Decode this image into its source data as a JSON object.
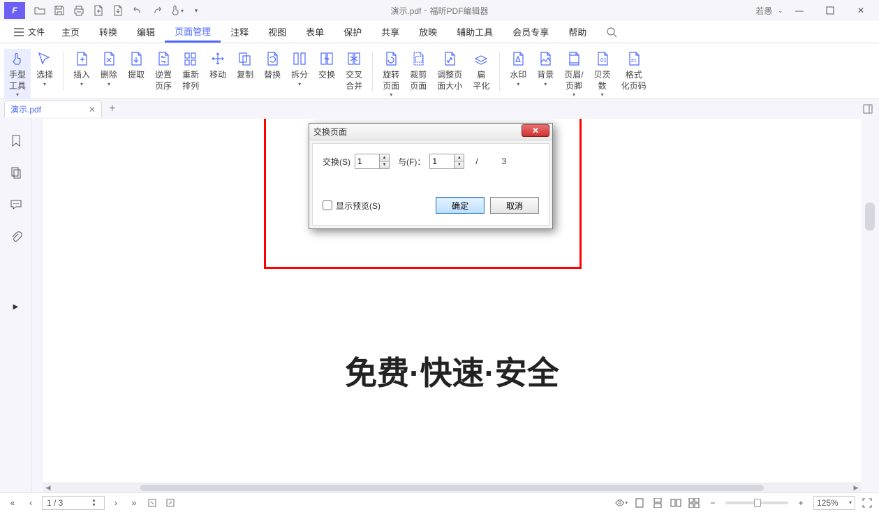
{
  "titlebar": {
    "doc_name": "演示.pdf",
    "separator": "-",
    "app_name": "福昕PDF编辑器",
    "user": "若愚"
  },
  "menu": {
    "file": "文件",
    "tabs": [
      "主页",
      "转换",
      "编辑",
      "页面管理",
      "注释",
      "视图",
      "表单",
      "保护",
      "共享",
      "放映",
      "辅助工具",
      "会员专享",
      "帮助"
    ],
    "active_index": 3
  },
  "ribbon": {
    "hand_tool": "手型\n工具",
    "select": "选择",
    "insert": "插入",
    "del": "删除",
    "extract": "提取",
    "reverse": "逆置\n页序",
    "rearrange": "重新\n排列",
    "move": "移动",
    "dup": "复制",
    "replace": "替换",
    "split": "拆分",
    "swap": "交换",
    "crossmerge": "交叉\n合并",
    "rotate": "旋转\n页面",
    "crop": "裁剪\n页面",
    "resize": "调整页\n面大小",
    "flatten": "扁\n平化",
    "watermark": "水印",
    "bg": "背景",
    "headerfooter": "页眉/\n页脚",
    "bates": "贝茨\n数",
    "format_num": "格式\n化页码"
  },
  "doc_tab": {
    "name": "演示.pdf"
  },
  "page_content": "免费·快速·安全",
  "dialog": {
    "title": "交换页面",
    "swap_label": "交换(S)",
    "with_label": "与(F)：",
    "swap_val": "1",
    "with_val": "1",
    "total_sep": "/",
    "total": "3",
    "preview": "显示预览(S)",
    "ok": "确定",
    "cancel": "取消"
  },
  "status": {
    "page": "1 / 3",
    "zoom": "125%"
  }
}
